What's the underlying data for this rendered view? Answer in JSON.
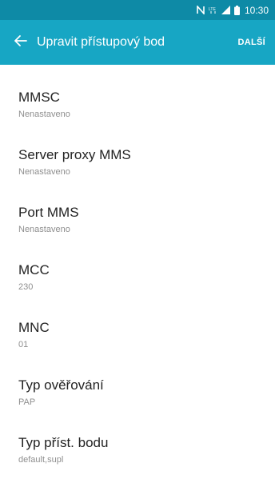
{
  "status_bar": {
    "time": "10:30",
    "network": "LTE"
  },
  "app_bar": {
    "title": "Upravit přístupový bod",
    "next_label": "DALŠÍ"
  },
  "settings": [
    {
      "label": "MMSC",
      "value": "Nenastaveno"
    },
    {
      "label": "Server proxy MMS",
      "value": "Nenastaveno"
    },
    {
      "label": "Port MMS",
      "value": "Nenastaveno"
    },
    {
      "label": "MCC",
      "value": "230"
    },
    {
      "label": "MNC",
      "value": "01"
    },
    {
      "label": "Typ ověřování",
      "value": "PAP"
    },
    {
      "label": "Typ příst. bodu",
      "value": "default,supl"
    }
  ],
  "colors": {
    "status_bar": "#0e8aa6",
    "app_bar": "#17a6c4",
    "primary_text": "#222222",
    "secondary_text": "#8f8f8f"
  },
  "icons": [
    "nfc-icon",
    "lte-icon",
    "signal-icon",
    "battery-icon",
    "back-arrow-icon"
  ]
}
